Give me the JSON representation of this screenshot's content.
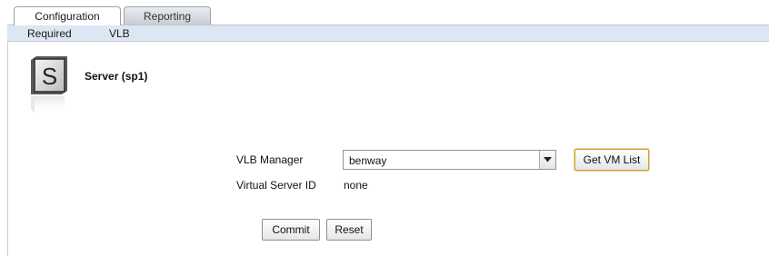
{
  "tabs": [
    {
      "label": "Configuration",
      "active": true
    },
    {
      "label": "Reporting",
      "active": false
    }
  ],
  "subnav": {
    "required": "Required",
    "vlb": "VLB"
  },
  "server": {
    "icon": "server-s-icon",
    "icon_letter": "S",
    "title": "Server (sp1)"
  },
  "form": {
    "vlb_manager_label": "VLB Manager",
    "vlb_manager_value": "benway",
    "get_vm_list_label": "Get VM List",
    "virtual_server_id_label": "Virtual Server ID",
    "virtual_server_id_value": "none",
    "commit_label": "Commit",
    "reset_label": "Reset"
  },
  "colors": {
    "subnav_bg": "#dde7f3",
    "tab_border": "#9aa3ad",
    "focus_ring": "#f2d27a"
  }
}
